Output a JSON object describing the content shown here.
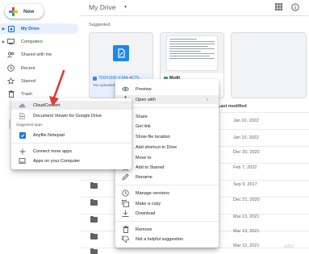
{
  "sidebar": {
    "new_label": "New",
    "items": [
      {
        "label": "My Drive",
        "icon": "my-drive-icon",
        "active": true
      },
      {
        "label": "Computers",
        "icon": "computers-icon",
        "active": false
      },
      {
        "label": "Shared with me",
        "icon": "shared-with-me-icon",
        "active": false
      },
      {
        "label": "Recent",
        "icon": "recent-icon",
        "active": false
      },
      {
        "label": "Starred",
        "icon": "star-icon",
        "active": false
      },
      {
        "label": "Trash",
        "icon": "trash-icon",
        "active": false
      }
    ]
  },
  "header": {
    "title": "My Drive",
    "grid_icon": "grid-view-icon",
    "info_icon": "info-icon"
  },
  "suggested": {
    "label": "Suggested",
    "cards": [
      {
        "name": "7D04160F-F344-4C75-",
        "sub": "You uploaded this"
      },
      {
        "name": "Mydit",
        "sub": "You edited in the past week"
      }
    ]
  },
  "file_list": {
    "column_header": "Last modified",
    "dates": [
      "Jan 10, 2022",
      "Jan 10, 2022",
      "Dec 30, 2020",
      "Feb 7, 2022",
      "Sep 9, 2017",
      "Dec 21, 2020",
      "Mar 13, 2021",
      "Mar 13, 2021",
      "Mar 12, 2021"
    ]
  },
  "context_menu": {
    "items": [
      {
        "label": "Preview",
        "icon": "preview-eye-icon"
      },
      {
        "label": "Open with",
        "icon": "open-with-arrows-icon",
        "submenu": true
      },
      {
        "label": "Share",
        "icon": "share-person-add-icon"
      },
      {
        "label": "Get link",
        "icon": "link-icon"
      },
      {
        "label": "Show file location",
        "icon": "folder-icon"
      },
      {
        "label": "Add shortcut to Drive",
        "icon": "add-shortcut-icon"
      },
      {
        "label": "Move to",
        "icon": "move-to-icon"
      },
      {
        "label": "Add to Starred",
        "icon": "star-icon"
      },
      {
        "label": "Rename",
        "icon": "rename-pencil-icon"
      },
      {
        "label": "Manage versions",
        "icon": "history-icon"
      },
      {
        "label": "Make a copy",
        "icon": "copy-icon"
      },
      {
        "label": "Download",
        "icon": "download-icon"
      },
      {
        "label": "Remove",
        "icon": "trash-icon"
      },
      {
        "label": "Not a helpful suggestion",
        "icon": "thumb-down-icon"
      }
    ]
  },
  "open_with_menu": {
    "items": [
      {
        "label": "CloudConvert",
        "icon": "cloudconvert-icon"
      },
      {
        "label": "Document Viewer for Google Drive",
        "icon": "document-viewer-icon"
      }
    ],
    "suggested_caption": "Suggested apps",
    "suggested_apps": [
      {
        "label": "Anyfile Notepad",
        "icon": "anyfile-notepad-icon"
      }
    ],
    "footer_items": [
      {
        "label": "Connect more apps",
        "icon": "plus-icon"
      },
      {
        "label": "Apps on your Computer",
        "icon": "computer-icon"
      }
    ]
  },
  "watermark": "·php",
  "colors": {
    "accent": "#1a73e8",
    "active_bg": "#e8f0fe",
    "annotation": "#e53935"
  }
}
